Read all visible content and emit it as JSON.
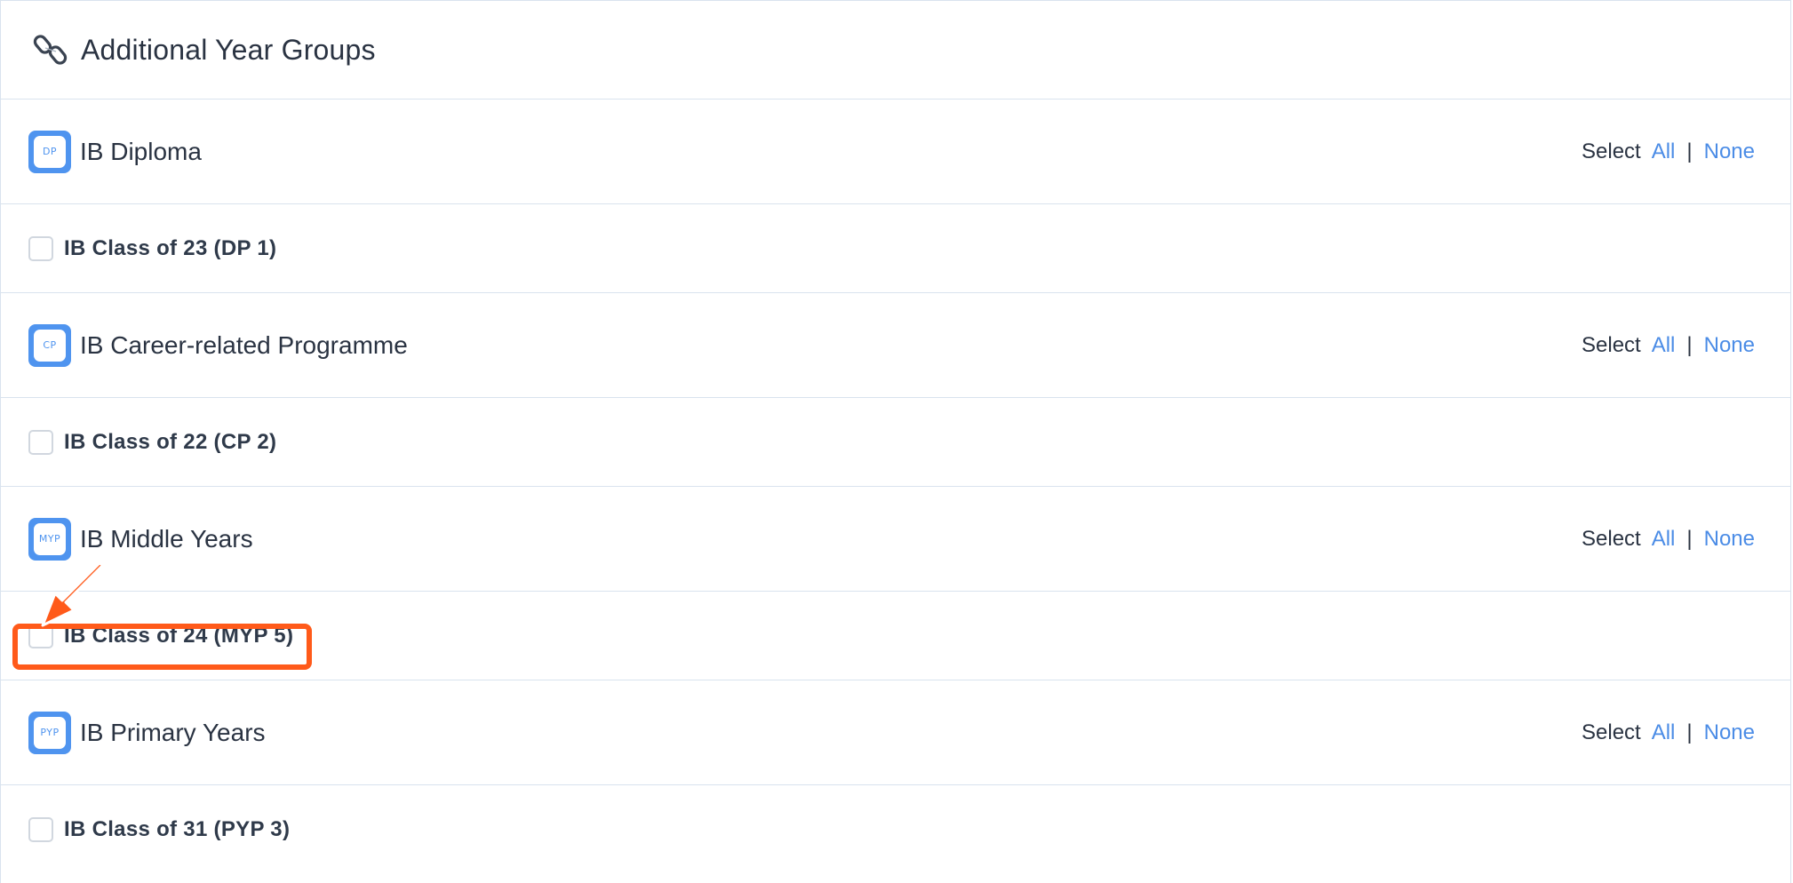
{
  "header": {
    "title": "Additional Year Groups",
    "icon": "link-icon"
  },
  "sections": [
    {
      "programme": "IB Diploma",
      "badge": "DP",
      "select_label": "Select",
      "all_label": "All",
      "separator": "|",
      "none_label": "None",
      "items": [
        {
          "label": "IB Class of 23 (DP 1)",
          "checked": false
        }
      ]
    },
    {
      "programme": "IB Career-related Programme",
      "badge": "CP",
      "select_label": "Select",
      "all_label": "All",
      "separator": "|",
      "none_label": "None",
      "items": [
        {
          "label": "IB Class of 22 (CP 2)",
          "checked": false
        }
      ]
    },
    {
      "programme": "IB Middle Years",
      "badge": "MYP",
      "select_label": "Select",
      "all_label": "All",
      "separator": "|",
      "none_label": "None",
      "items": [
        {
          "label": "IB Class of 24 (MYP 5)",
          "checked": false
        }
      ]
    },
    {
      "programme": "IB Primary Years",
      "badge": "PYP",
      "select_label": "Select",
      "all_label": "All",
      "separator": "|",
      "none_label": "None",
      "items": [
        {
          "label": "IB Class of 31 (PYP 3)",
          "checked": false
        }
      ]
    }
  ],
  "colors": {
    "accent": "#4f94ef",
    "link": "#4b8ce6",
    "highlight": "#ff5a1a",
    "border": "#d9e3ee"
  }
}
